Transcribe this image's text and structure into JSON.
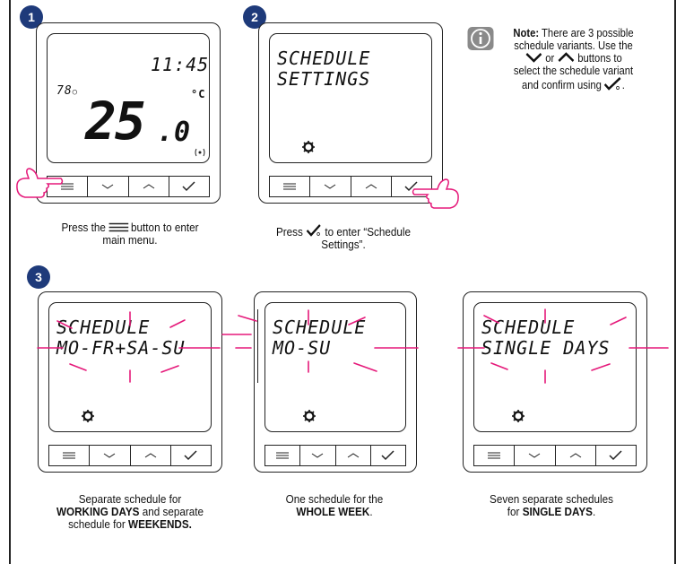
{
  "steps": [
    {
      "number": "1"
    },
    {
      "number": "2"
    },
    {
      "number": "3"
    }
  ],
  "device1": {
    "time": "11:45",
    "humidity": "78",
    "unit": "°C",
    "temperature_main": "25",
    "temperature_decimal": ".0"
  },
  "device2": {
    "line1": "SCHEDULE",
    "line2": "SETTINGS"
  },
  "variants": [
    {
      "line1": "SCHEDULE",
      "line2": "MO-FR+SA-SU"
    },
    {
      "line1": "SCHEDULE",
      "line2": "MO-SU"
    },
    {
      "line1": "SCHEDULE",
      "line2": "SINGLE DAYS"
    }
  ],
  "captions": {
    "step1_a": "Press the",
    "step1_b": "button to enter",
    "step1_c": "main menu.",
    "step2_a": "Press",
    "step2_b": "to enter “Schedule",
    "step2_c": "Settings”.",
    "v1_a": "Separate schedule for",
    "v1_b": "WORKING DAYS",
    "v1_c": " and separate",
    "v1_d": "schedule for ",
    "v1_e": "WEEKENDS.",
    "v2_a": "One schedule for the",
    "v2_b": "WHOLE WEEK",
    "v2_c": ".",
    "v3_a": "Seven separate schedules",
    "v3_b": "for ",
    "v3_c": "SINGLE DAYS",
    "v3_d": "."
  },
  "note": {
    "label": "Note:",
    "text1": " There are 3 possible",
    "text2": "schedule variants. Use the",
    "text3": "or",
    "text4": "buttons to",
    "text5": "select the schedule variant",
    "text6": "and confirm using",
    "text7": "."
  },
  "colors": {
    "badge": "#1e3a7a",
    "highlight": "#e5197a",
    "info_icon": "#8a8a8a"
  },
  "icons": [
    "menu-icon",
    "chevron-down-icon",
    "chevron-up-icon",
    "confirm-check-icon",
    "gear-icon",
    "info-icon",
    "pointing-hand-icon",
    "wireless-icon",
    "droplet-icon"
  ]
}
